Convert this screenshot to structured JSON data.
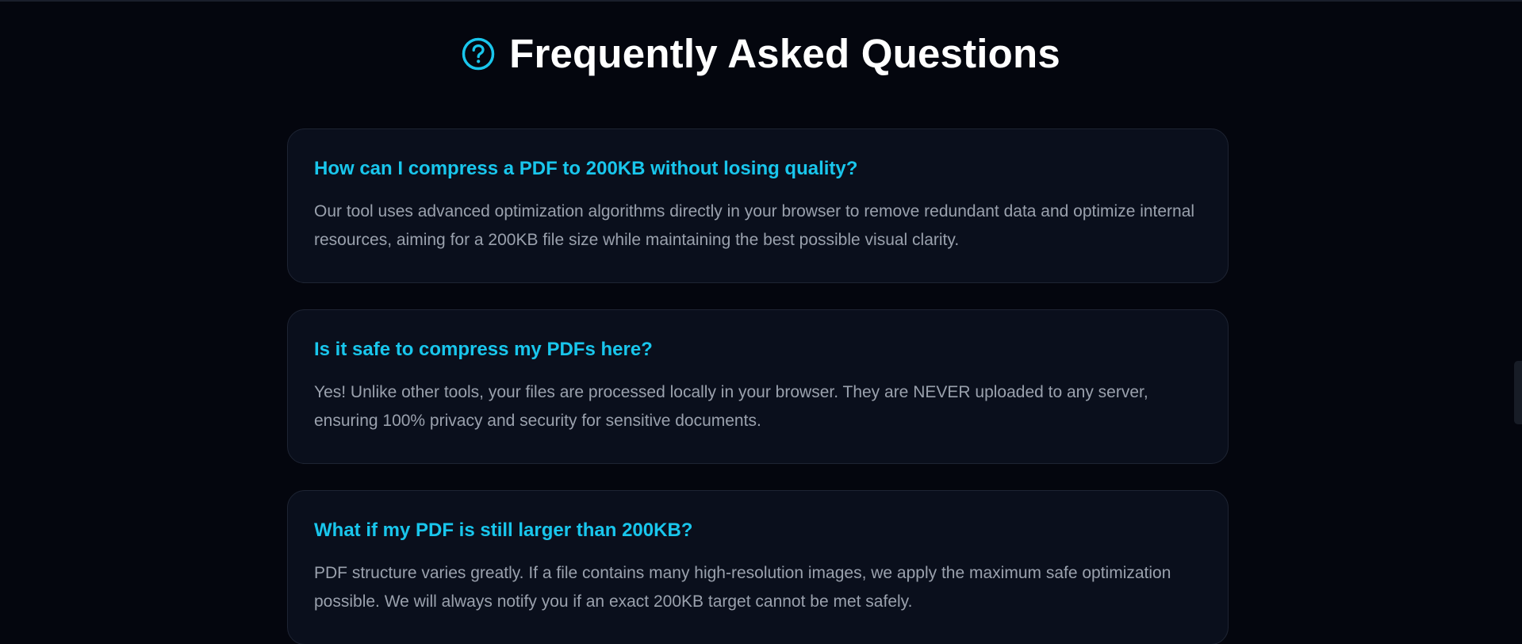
{
  "header": {
    "title": "Frequently Asked Questions",
    "icon": "question-circle-icon",
    "accent_color": "#19c6ec"
  },
  "faqs": [
    {
      "question": "How can I compress a PDF to 200KB without losing quality?",
      "answer": "Our tool uses advanced optimization algorithms directly in your browser to remove redundant data and optimize internal resources, aiming for a 200KB file size while maintaining the best possible visual clarity."
    },
    {
      "question": "Is it safe to compress my PDFs here?",
      "answer": "Yes! Unlike other tools, your files are processed locally in your browser. They are NEVER uploaded to any server, ensuring 100% privacy and security for sensitive documents."
    },
    {
      "question": "What if my PDF is still larger than 200KB?",
      "answer": "PDF structure varies greatly. If a file contains many high-resolution images, we apply the maximum safe optimization possible. We will always notify you if an exact 200KB target cannot be met safely."
    }
  ],
  "colors": {
    "background": "#04060e",
    "card_background": "#0a0f1c",
    "card_border": "#1e2433",
    "question_text": "#19c6ec",
    "answer_text": "#9aa1ad",
    "title_text": "#ffffff"
  }
}
